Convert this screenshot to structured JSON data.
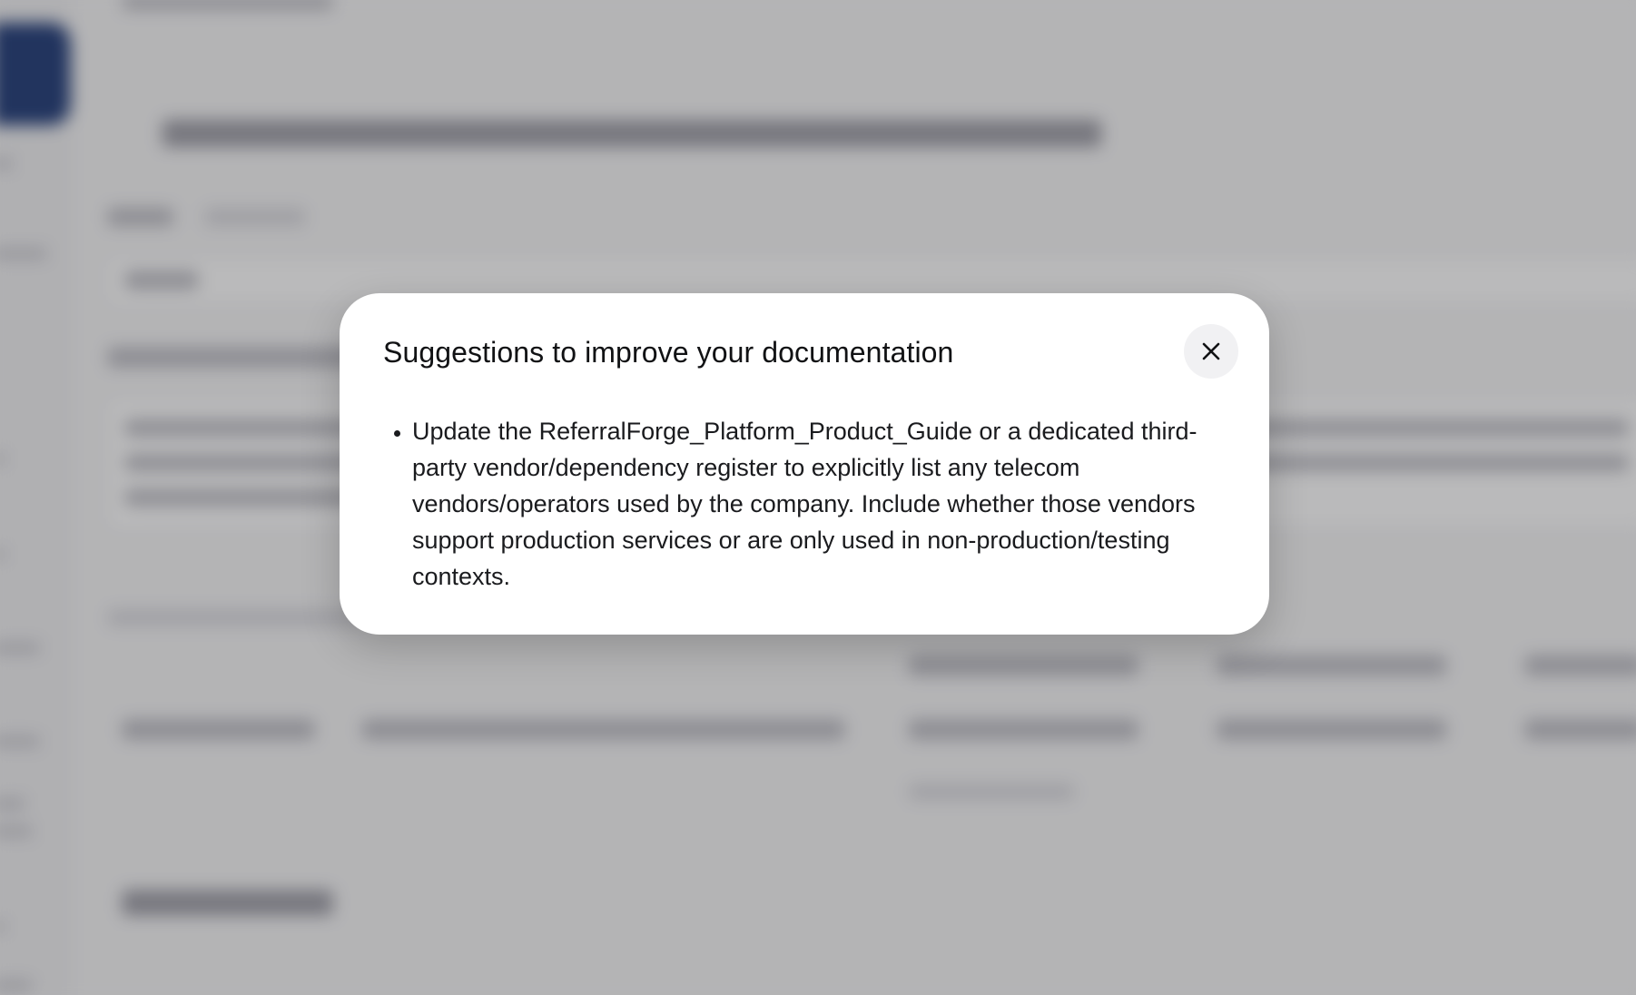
{
  "modal": {
    "title": "Suggestions to improve your documentation",
    "close_icon": "close-icon",
    "suggestions": [
      "Update the ReferralForge_Platform_Product_Guide or a dedicated third-party vendor/dependency register to explicitly list any telecom vendors/operators used by the company. Include whether those vendors support production services or are only used in non-production/testing contexts."
    ]
  },
  "colors": {
    "modal_background": "#ffffff",
    "overlay": "#28282c",
    "brand_accent": "#1f3a77",
    "close_button_background": "#f1f1f3",
    "text": "#111214"
  }
}
